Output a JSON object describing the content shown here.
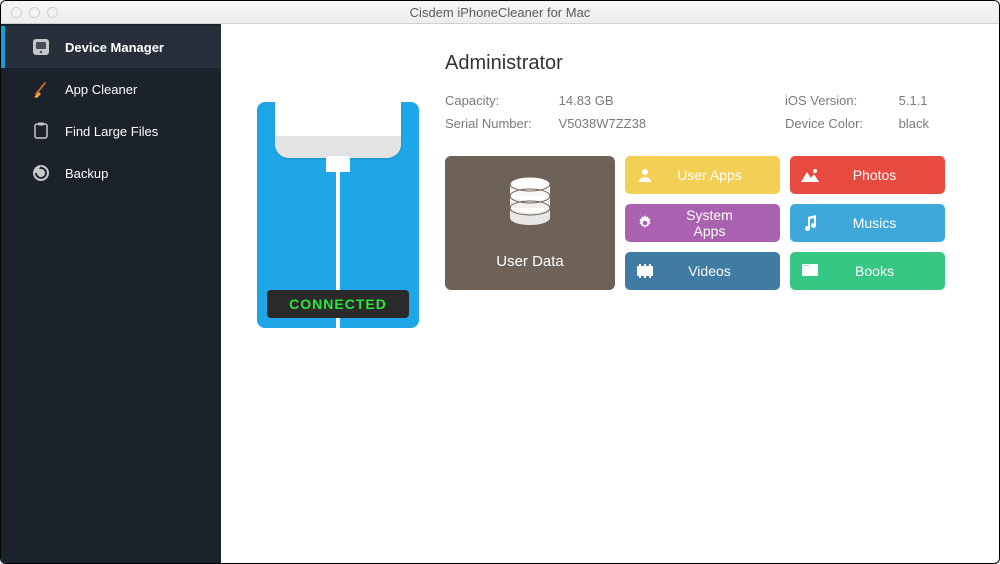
{
  "window": {
    "title": "Cisdem iPhoneCleaner for Mac"
  },
  "sidebar": {
    "items": [
      {
        "label": "Device Manager"
      },
      {
        "label": "App Cleaner"
      },
      {
        "label": "Find Large Files"
      },
      {
        "label": "Backup"
      }
    ]
  },
  "device": {
    "status": "CONNECTED",
    "name": "Administrator",
    "capacity_label": "Capacity:",
    "capacity": "14.83 GB",
    "serial_label": "Serial Number:",
    "serial": "V5038W7ZZ38",
    "ios_label": "iOS Version:",
    "ios": "5.1.1",
    "color_label": "Device Color:",
    "color": "black"
  },
  "tiles": {
    "user_data": "User Data",
    "user_apps": "User Apps",
    "photos": "Photos",
    "system_apps": "System Apps",
    "musics": "Musics",
    "videos": "Videos",
    "books": "Books"
  }
}
